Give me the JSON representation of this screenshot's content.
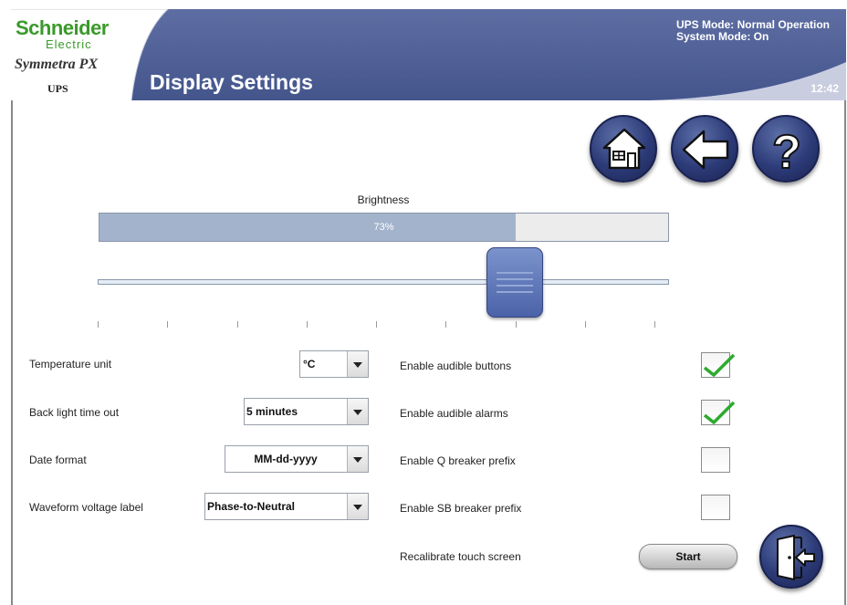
{
  "header": {
    "brand": "Schneider",
    "brand_sub": "Electric",
    "product": "Symmetra PX",
    "product_sub": "UPS",
    "title": "Display Settings",
    "ups_mode": "UPS Mode: Normal Operation",
    "system_mode": "System Mode: On",
    "clock": "12:42"
  },
  "nav": {
    "home_icon": "home-icon",
    "back_icon": "back-arrow-icon",
    "help_icon": "help-icon",
    "exit_icon": "exit-door-icon"
  },
  "brightness": {
    "label": "Brightness",
    "value_text": "73%",
    "level": 0.73,
    "ticks": 9
  },
  "settings": {
    "temperature": {
      "label": "Temperature unit",
      "value": "°C"
    },
    "backlight": {
      "label": "Back light time out",
      "value": "5 minutes"
    },
    "date_format": {
      "label": "Date format",
      "value": "MM-dd-yyyy"
    },
    "waveform": {
      "label": "Waveform voltage label",
      "value": "Phase-to-Neutral"
    }
  },
  "toggles": {
    "audible_buttons": {
      "label": "Enable audible buttons",
      "checked": true
    },
    "audible_alarms": {
      "label": "Enable audible alarms",
      "checked": true
    },
    "q_breaker": {
      "label": "Enable Q breaker prefix",
      "checked": false
    },
    "sb_breaker": {
      "label": "Enable SB breaker prefix",
      "checked": false
    }
  },
  "recalibrate": {
    "label": "Recalibrate touch screen",
    "button": "Start"
  },
  "colors": {
    "header_blue": "#4f5f94",
    "brand_green": "#3a9a2a",
    "bar_fill": "#a3b3cc"
  }
}
